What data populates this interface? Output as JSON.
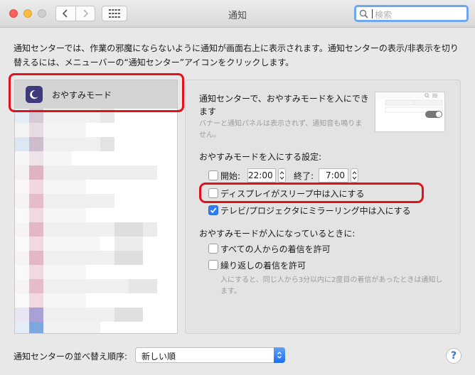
{
  "window": {
    "title": "通知"
  },
  "search": {
    "placeholder": "検索"
  },
  "description": "通知センターでは、作業の邪魔にならないように通知が画面右上に表示されます。通知センターの表示/非表示を切り替えるには、メニューバーの“通知センター”アイコンをクリックします。",
  "sidebar": {
    "selected_item": "おやすみモード",
    "selected_icon": "moon-icon"
  },
  "dnd": {
    "heading": "通知センターで、おやすみモードを入にできます",
    "subtext": "バナーと通知パネルは表示されず、通知音も鳴りません。",
    "schedule_heading": "おやすみモードを入にする設定:",
    "start_label": "開始:",
    "start_time": "22:00",
    "start_checked": false,
    "end_label": "終了:",
    "end_time": "7:00",
    "display_sleep_label": "ディスプレイがスリープ中は入にする",
    "display_sleep_checked": false,
    "mirroring_label": "テレビ/プロジェクタにミラーリング中は入にする",
    "mirroring_checked": true,
    "when_on_heading": "おやすみモードが入になっているときに:",
    "allow_all_label": "すべての人からの着信を許可",
    "allow_all_checked": false,
    "repeated_label": "繰り返しの着信を許可",
    "repeated_checked": false,
    "repeated_note": "入にすると、同じ人から3分以内に2度目の着信があったときは通知します。"
  },
  "footer": {
    "sort_label": "通知センターの並べ替え順序:",
    "sort_value": "新しい順",
    "help_label": "?"
  },
  "colors": {
    "accent": "#2f7cf6",
    "highlight": "#e0121e",
    "moon_bg": "#3f3a7e"
  }
}
